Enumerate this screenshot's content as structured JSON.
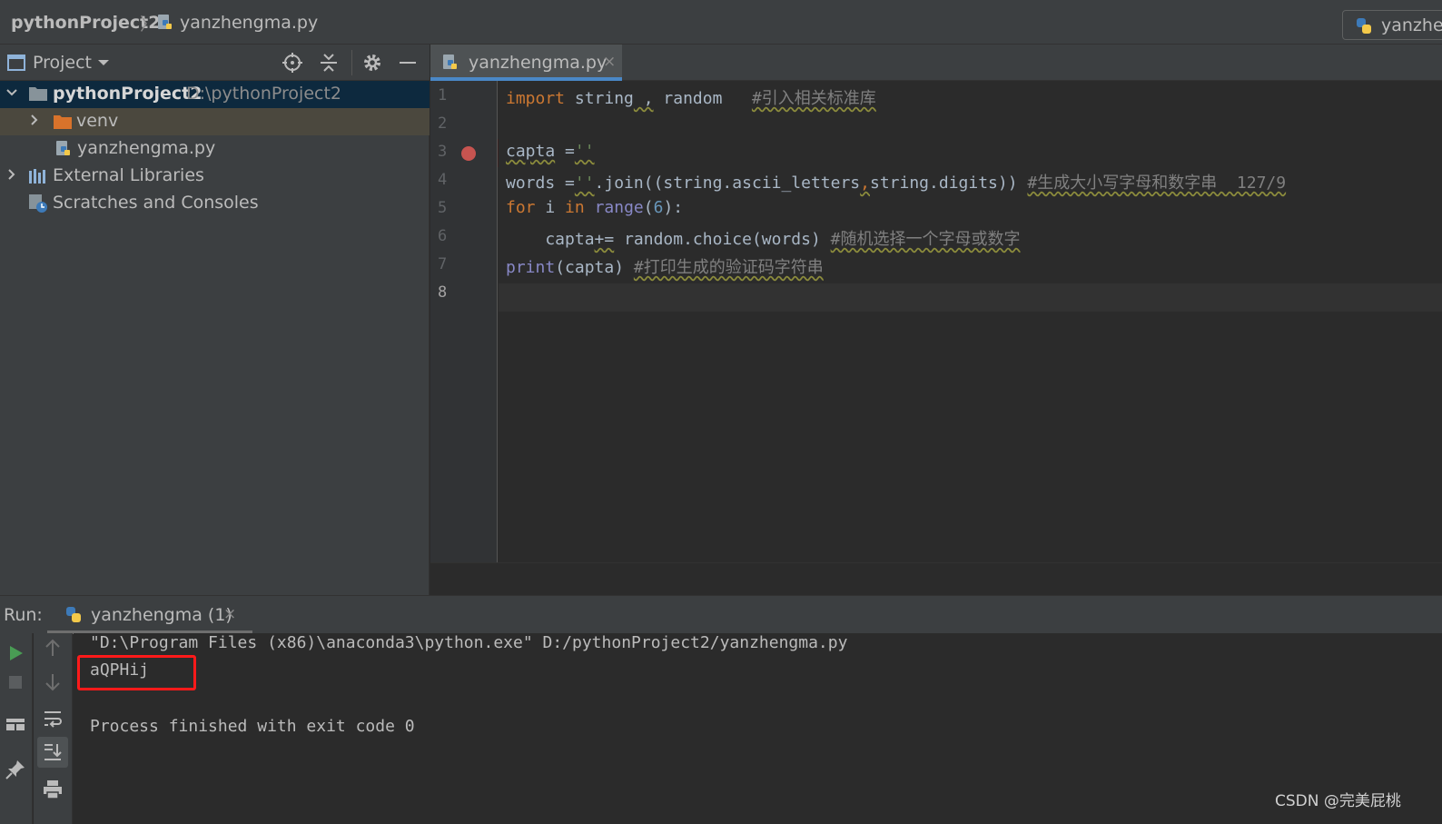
{
  "breadcrumb": {
    "project": "pythonProject2",
    "file": "yanzhengma.py",
    "run_config": "yanzhengma"
  },
  "project_panel": {
    "title": "Project",
    "tree": [
      {
        "label": "pythonProject2",
        "path": "D:\\pythonProject2"
      },
      {
        "label": "venv"
      },
      {
        "label": "yanzhengma.py"
      },
      {
        "label": "External Libraries"
      },
      {
        "label": "Scratches and Consoles"
      }
    ]
  },
  "editor": {
    "tab_label": "yanzhengma.py",
    "tab_close": "×",
    "line_numbers": [
      "1",
      "2",
      "3",
      "4",
      "5",
      "6",
      "7",
      "8"
    ],
    "code": {
      "l1_import": "import",
      "l1_mid": " string",
      "l1_comma": " ,",
      "l1_random": " random",
      "l1_comment": "#引入相关标准库",
      "l3_var": "capta",
      "l3_eq": " =",
      "l3_str": "''",
      "l4_a": "words =",
      "l4_str": "''",
      "l4_b": ".join((string.ascii_letters",
      "l4_c": ",",
      "l4_d": "string.digits))",
      "l4_comment": "#生成大小写字母和数字串  127/9",
      "l5_for": "for",
      "l5_i": " i ",
      "l5_in": "in",
      "l5_sp": " ",
      "l5_range": "range",
      "l5_paren": "(",
      "l5_num": "6",
      "l5_end": "):",
      "l6_a": "    capta",
      "l6_op": "+=",
      "l6_b": " random.choice(words)",
      "l6_comment": "#随机选择一个字母或数字",
      "l7_print": "print",
      "l7_b": "(capta)",
      "l7_comment": "#打印生成的验证码字符串"
    }
  },
  "run_panel": {
    "label": "Run:",
    "tab_label": "yanzhengma (1)",
    "tab_close": "×",
    "console": [
      "\"D:\\Program Files (x86)\\anaconda3\\python.exe\" D:/pythonProject2/yanzhengma.py",
      "aQPHij",
      "",
      "Process finished with exit code 0"
    ]
  },
  "watermark": "CSDN @完美屁桃",
  "colors": {
    "keyword": "#cc7832",
    "builtin": "#8888c6",
    "number": "#6897bb",
    "string": "#6a8759",
    "comment": "#808080",
    "breakpoint": "#c75450",
    "highlight_box": "#ff1a1a",
    "run_green": "#499c54"
  },
  "icons": [
    "folder-icon",
    "python-file-icon",
    "libraries-icon",
    "scratches-icon",
    "locate-icon",
    "collapse-all-icon",
    "gear-icon",
    "minimize-icon",
    "run-icon",
    "stop-icon",
    "layout-icon",
    "pin-icon",
    "up-arrow-icon",
    "down-arrow-icon",
    "soft-wrap-icon",
    "scroll-to-end-icon",
    "print-icon"
  ]
}
